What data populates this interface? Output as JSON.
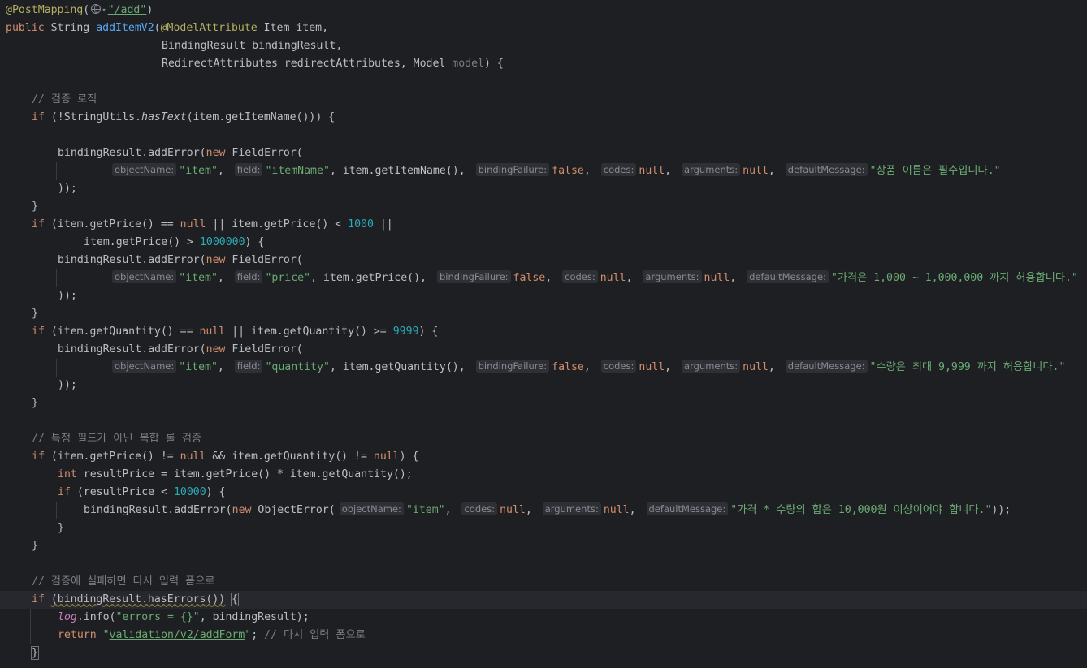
{
  "code": {
    "annotation_mapping": "@PostMapping",
    "mapping_path": "/add",
    "public_kw": "public",
    "string_type": "String",
    "method_name": "addItemV2",
    "model_attr": "@ModelAttribute",
    "param1": "Item item,",
    "param2": "BindingResult bindingResult,",
    "param3": "RedirectAttributes redirectAttributes, Model",
    "param3_unused": "model",
    "comment_validation": "// 검증 로직",
    "comment_global": "// 특정 필드가 아닌 복합 룰 검증",
    "comment_fail": "// 검증에 실패하면 다시 입력 폼으로",
    "comment_return": "// 다시 입력 폼으로",
    "if_kw": "if",
    "new_kw": "new",
    "null_kw": "null",
    "false_kw": "false",
    "int_kw": "int",
    "return_kw": "return",
    "string_utils": "(!StringUtils.",
    "has_text": "hasText",
    "item_name_call": "(item.getItemName())) {",
    "add_error": "bindingResult.addError(",
    "field_error": "FieldError(",
    "object_error": "ObjectError(",
    "close_call": "));",
    "close_brace": "}",
    "hint_object_name": "objectName:",
    "hint_field": "field:",
    "hint_binding_failure": "bindingFailure:",
    "hint_codes": "codes:",
    "hint_arguments": "arguments:",
    "hint_default_message": "defaultMessage:",
    "str_item": "\"item\"",
    "str_item_name": "\"itemName\"",
    "str_price": "\"price\"",
    "str_quantity": "\"quantity\"",
    "get_item_name": "item.getItemName(),",
    "get_price": "item.getPrice(),",
    "get_quantity": "item.getQuantity(),",
    "msg_name": "\"상품 이름은 필수입니다.\"",
    "msg_price": "\"가격은 1,000 ~ 1,000,000 까지 허용합니다.\"",
    "msg_quantity": "\"수량은 최대 9,999 까지 허용합니다.\"",
    "msg_global": "\"가격 * 수량의 합은 10,000원 이상이어야 합니다.\"",
    "price_cond_a": "(item.getPrice() ==",
    "price_cond_b": "|| item.getPrice() <",
    "num_1000": "1000",
    "price_cond_c": "||",
    "price_cond_d": "item.getPrice() >",
    "num_1000000": "1000000",
    "cond_close": ") {",
    "qty_cond_a": "(item.getQuantity() ==",
    "qty_cond_b": "|| item.getQuantity() >=",
    "num_9999": "9999",
    "global_cond_a": "(item.getPrice() !=",
    "global_cond_b": "&& item.getQuantity() !=",
    "result_price_decl": "resultPrice = item.getPrice() * item.getQuantity();",
    "result_cond": "(resultPrice <",
    "num_10000": "10000",
    "has_errors": "(bindingResult.hasErrors())",
    "open_brace": "{",
    "log_var": "log",
    "log_info": ".info(",
    "log_str": "\"errors = {}\"",
    "log_rest": ", bindingResult);",
    "return_view": "validation/v2/addForm",
    "semicolon": ";"
  }
}
